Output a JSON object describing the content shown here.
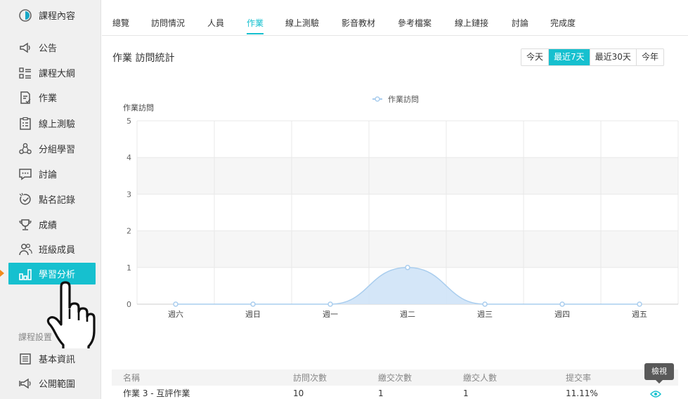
{
  "sidebar": {
    "items": [
      {
        "label": "課程內容",
        "icon": "course-content-icon"
      },
      {
        "label": "公告",
        "icon": "megaphone-icon"
      },
      {
        "label": "課程大綱",
        "icon": "outline-list-icon"
      },
      {
        "label": "作業",
        "icon": "homework-icon"
      },
      {
        "label": "線上測驗",
        "icon": "clipboard-test-icon"
      },
      {
        "label": "分組學習",
        "icon": "group-learning-icon"
      },
      {
        "label": "討論",
        "icon": "chat-bubble-icon"
      },
      {
        "label": "點名記錄",
        "icon": "roll-call-icon"
      },
      {
        "label": "成績",
        "icon": "trophy-icon"
      },
      {
        "label": "班級成員",
        "icon": "members-icon"
      },
      {
        "label": "學習分析",
        "icon": "bar-analytics-icon",
        "active": true
      }
    ],
    "settings_title": "課程設置",
    "settings_items": [
      {
        "label": "基本資訊",
        "icon": "info-doc-icon"
      },
      {
        "label": "公開範圍",
        "icon": "broadcast-icon"
      }
    ]
  },
  "tabs": [
    "總覽",
    "訪問情況",
    "人員",
    "作業",
    "線上測驗",
    "影音教材",
    "參考檔案",
    "線上鏈接",
    "討論",
    "完成度"
  ],
  "active_tab": "作業",
  "section_title": "作業 訪問統計",
  "range_buttons": [
    "今天",
    "最近7天",
    "最近30天",
    "今年"
  ],
  "active_range": "最近7天",
  "chart_data": {
    "type": "area",
    "title": "",
    "legend": "作業訪問",
    "legend_position": "top-center",
    "ylabel": "作業訪問",
    "xlabel": "",
    "categories": [
      "週六",
      "週日",
      "週一",
      "週二",
      "週三",
      "週四",
      "週五"
    ],
    "series": [
      {
        "name": "作業訪問",
        "values": [
          0,
          0,
          0,
          1,
          0,
          0,
          0
        ]
      }
    ],
    "ylim": [
      0,
      5
    ],
    "yticks": [
      0,
      1,
      2,
      3,
      4,
      5
    ],
    "grid": true,
    "color": "#a9cdee"
  },
  "table": {
    "headers": [
      "名稱",
      "訪問次數",
      "繳交次數",
      "繳交人數",
      "提交率"
    ],
    "rows": [
      {
        "name": "作業 3 - 互評作業",
        "visits": "10",
        "submissions": "1",
        "submitters": "1",
        "rate": "11.11%"
      }
    ],
    "tooltip": "檢視"
  },
  "colors": {
    "accent": "#16c0cf",
    "marker": "#f08a1c"
  }
}
